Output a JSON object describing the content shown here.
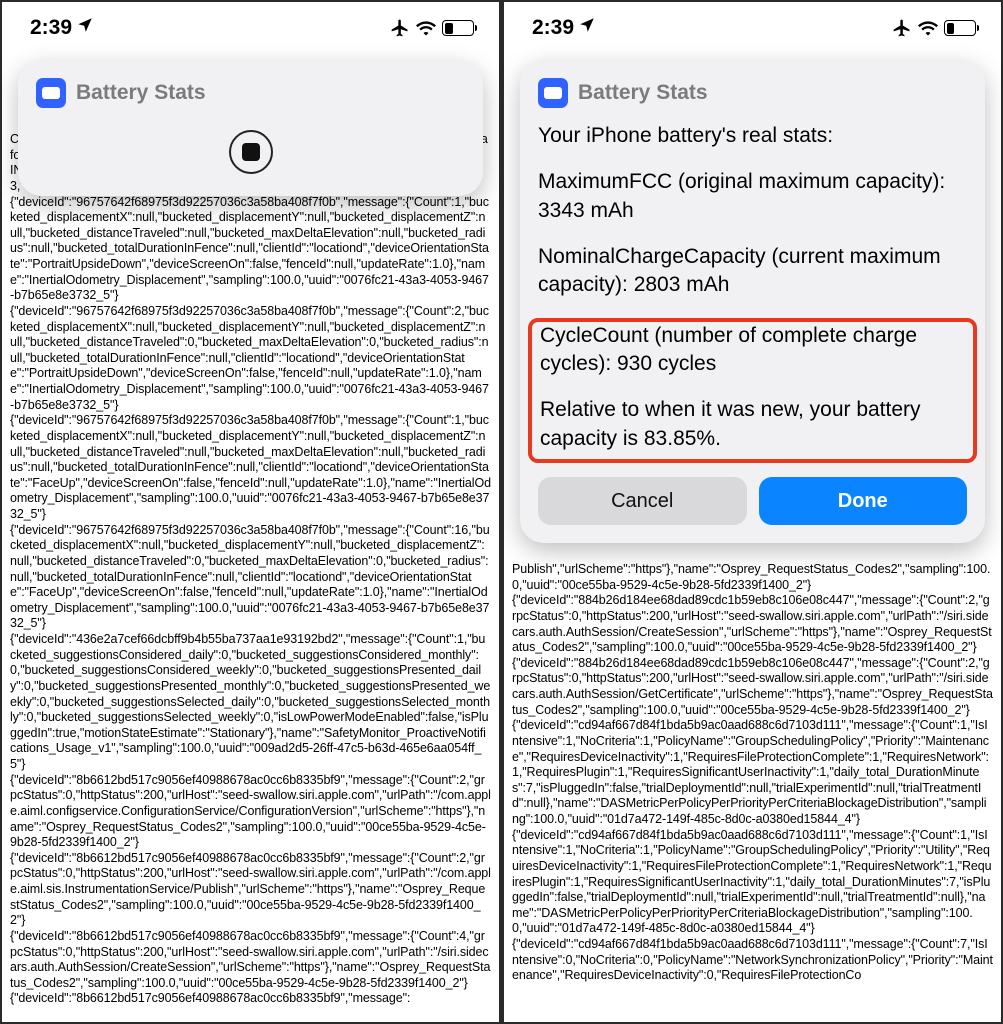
{
  "statusbar": {
    "time": "2:39",
    "battery_left": "30",
    "battery_right": "29"
  },
  "card": {
    "title": "Battery Stats"
  },
  "stats": {
    "heading": "Your iPhone battery's real stats:",
    "max_fcc": "MaximumFCC (original maximum capacity): 3343 mAh",
    "nominal": "NominalChargeCapacity (current maximum capacity): 2803 mAh",
    "cycles": "CycleCount (number of complete charge cycles): 930 cycles",
    "relative": "Relative to when it was new, your battery capacity is 83.85%."
  },
  "buttons": {
    "cancel": "Cancel",
    "done": "Done"
  },
  "bg_left": "Carrie.\",\"productSku\":\"HN/A\",\"rolloverReason\":\"scheduled\",\"servingCarrierName\":\"Vodafone India\nIN\",\"startTimestamp\":\"2024-01-05T00:15:00Z\",\"stateDbType\":\"sqlite\",\"stateDbVersion\":3,\"trialExperiments\":\"2\",\"trialRollouts\":\"2\",\"version\":\"2.4\"}\n{\"deviceId\":\"96757642f68975f3d92257036c3a58ba408f7f0b\",\"message\":{\"Count\":1,\"bucketed_displacementX\":null,\"bucketed_displacementY\":null,\"bucketed_displacementZ\":null,\"bucketed_distanceTraveled\":null,\"bucketed_maxDeltaElevation\":null,\"bucketed_radius\":null,\"bucketed_totalDurationInFence\":null,\"clientId\":\"locationd\",\"deviceOrientationState\":\"PortraitUpsideDown\",\"deviceScreenOn\":false,\"fenceId\":null,\"updateRate\":1.0},\"name\":\"InertialOdometry_Displacement\",\"sampling\":100.0,\"uuid\":\"0076fc21-43a3-4053-9467-b7b65e8e3732_5\"}\n{\"deviceId\":\"96757642f68975f3d92257036c3a58ba408f7f0b\",\"message\":{\"Count\":2,\"bucketed_displacementX\":null,\"bucketed_displacementY\":null,\"bucketed_displacementZ\":null,\"bucketed_distanceTraveled\":0,\"bucketed_maxDeltaElevation\":0,\"bucketed_radius\":null,\"bucketed_totalDurationInFence\":null,\"clientId\":\"locationd\",\"deviceOrientationState\":\"PortraitUpsideDown\",\"deviceScreenOn\":false,\"fenceId\":null,\"updateRate\":1.0},\"name\":\"InertialOdometry_Displacement\",\"sampling\":100.0,\"uuid\":\"0076fc21-43a3-4053-9467-b7b65e8e3732_5\"}\n{\"deviceId\":\"96757642f68975f3d92257036c3a58ba408f7f0b\",\"message\":{\"Count\":1,\"bucketed_displacementX\":null,\"bucketed_displacementY\":null,\"bucketed_displacementZ\":null,\"bucketed_distanceTraveled\":null,\"bucketed_maxDeltaElevation\":null,\"bucketed_radius\":null,\"bucketed_totalDurationInFence\":null,\"clientId\":\"locationd\",\"deviceOrientationState\":\"FaceUp\",\"deviceScreenOn\":false,\"fenceId\":null,\"updateRate\":1.0},\"name\":\"InertialOdometry_Displacement\",\"sampling\":100.0,\"uuid\":\"0076fc21-43a3-4053-9467-b7b65e8e3732_5\"}\n{\"deviceId\":\"96757642f68975f3d92257036c3a58ba408f7f0b\",\"message\":{\"Count\":16,\"bucketed_displacementX\":null,\"bucketed_displacementY\":null,\"bucketed_displacementZ\":null,\"bucketed_distanceTraveled\":0,\"bucketed_maxDeltaElevation\":0,\"bucketed_radius\":null,\"bucketed_totalDurationInFence\":null,\"clientId\":\"locationd\",\"deviceOrientationState\":\"FaceUp\",\"deviceScreenOn\":false,\"fenceId\":null,\"updateRate\":1.0},\"name\":\"InertialOdometry_Displacement\",\"sampling\":100.0,\"uuid\":\"0076fc21-43a3-4053-9467-b7b65e8e3732_5\"}\n{\"deviceId\":\"436e2a7cef66dcbff9b4b55ba737aa1e93192bd2\",\"message\":{\"Count\":1,\"bucketed_suggestionsConsidered_daily\":0,\"bucketed_suggestionsConsidered_monthly\":0,\"bucketed_suggestionsConsidered_weekly\":0,\"bucketed_suggestionsPresented_daily\":0,\"bucketed_suggestionsPresented_monthly\":0,\"bucketed_suggestionsPresented_weekly\":0,\"bucketed_suggestionsSelected_daily\":0,\"bucketed_suggestionsSelected_monthly\":0,\"bucketed_suggestionsSelected_weekly\":0,\"isLowPowerModeEnabled\":false,\"isPluggedIn\":true,\"motionStateEstimate\":\"Stationary\"},\"name\":\"SafetyMonitor_ProactiveNotifications_Usage_v1\",\"sampling\":100.0,\"uuid\":\"009ad2d5-26ff-47c5-b63d-465e6aa054ff_5\"}\n{\"deviceId\":\"8b6612bd517c9056ef40988678ac0cc6b8335bf9\",\"message\":{\"Count\":2,\"grpcStatus\":0,\"httpStatus\":200,\"urlHost\":\"seed-swallow.siri.apple.com\",\"urlPath\":\"/com.apple.aiml.configservice.ConfigurationService/ConfigurationVersion\",\"urlScheme\":\"https\"},\"name\":\"Osprey_RequestStatus_Codes2\",\"sampling\":100.0,\"uuid\":\"00ce55ba-9529-4c5e-9b28-5fd2339f1400_2\"}\n{\"deviceId\":\"8b6612bd517c9056ef40988678ac0cc6b8335bf9\",\"message\":{\"Count\":2,\"grpcStatus\":0,\"httpStatus\":200,\"urlHost\":\"seed-swallow.siri.apple.com\",\"urlPath\":\"/com.apple.aiml.sis.InstrumentationService/Publish\",\"urlScheme\":\"https\"},\"name\":\"Osprey_RequestStatus_Codes2\",\"sampling\":100.0,\"uuid\":\"00ce55ba-9529-4c5e-9b28-5fd2339f1400_2\"}\n{\"deviceId\":\"8b6612bd517c9056ef40988678ac0cc6b8335bf9\",\"message\":{\"Count\":4,\"grpcStatus\":0,\"httpStatus\":200,\"urlHost\":\"seed-swallow.siri.apple.com\",\"urlPath\":\"/siri.sidecars.auth.AuthSession/CreateSession\",\"urlScheme\":\"https\"},\"name\":\"Osprey_RequestStatus_Codes2\",\"sampling\":100.0,\"uuid\":\"00ce55ba-9529-4c5e-9b28-5fd2339f1400_2\"}\n{\"deviceId\":\"8b6612bd517c9056ef40988678ac0cc6b8335bf9\",\"message\":",
  "bg_right": "Publish\",\"urlScheme\":\"https\"},\"name\":\"Osprey_RequestStatus_Codes2\",\"sampling\":100.0,\"uuid\":\"00ce55ba-9529-4c5e-9b28-5fd2339f1400_2\"}\n{\"deviceId\":\"884b26d184ee68dad89cdc1b59eb8c106e08c447\",\"message\":{\"Count\":2,\"grpcStatus\":0,\"httpStatus\":200,\"urlHost\":\"seed-swallow.siri.apple.com\",\"urlPath\":\"/siri.sidecars.auth.AuthSession/CreateSession\",\"urlScheme\":\"https\"},\"name\":\"Osprey_RequestStatus_Codes2\",\"sampling\":100.0,\"uuid\":\"00ce55ba-9529-4c5e-9b28-5fd2339f1400_2\"}\n{\"deviceId\":\"884b26d184ee68dad89cdc1b59eb8c106e08c447\",\"message\":{\"Count\":2,\"grpcStatus\":0,\"httpStatus\":200,\"urlHost\":\"seed-swallow.siri.apple.com\",\"urlPath\":\"/siri.sidecars.auth.AuthSession/GetCertificate\",\"urlScheme\":\"https\"},\"name\":\"Osprey_RequestStatus_Codes2\",\"sampling\":100.0,\"uuid\":\"00ce55ba-9529-4c5e-9b28-5fd2339f1400_2\"}\n{\"deviceId\":\"cd94af667d84f1bda5b9ac0aad688c6d7103d111\",\"message\":{\"Count\":1,\"IsIntensive\":1,\"NoCriteria\":1,\"PolicyName\":\"GroupSchedulingPolicy\",\"Priority\":\"Maintenance\",\"RequiresDeviceInactivity\":1,\"RequiresFileProtectionComplete\":1,\"RequiresNetwork\":1,\"RequiresPlugin\":1,\"RequiresSignificantUserInactivity\":1,\"daily_total_DurationMinutes\":7,\"isPluggedIn\":false,\"trialDeploymentId\":null,\"trialExperimentId\":null,\"trialTreatmentId\":null},\"name\":\"DASMetricPerPolicyPerPriorityPerCriteriaBlockageDistribution\",\"sampling\":100.0,\"uuid\":\"01d7a472-149f-485c-8d0c-a0380ed15844_4\"}\n{\"deviceId\":\"cd94af667d84f1bda5b9ac0aad688c6d7103d111\",\"message\":{\"Count\":1,\"IsIntensive\":1,\"NoCriteria\":1,\"PolicyName\":\"GroupSchedulingPolicy\",\"Priority\":\"Utility\",\"RequiresDeviceInactivity\":1,\"RequiresFileProtectionComplete\":1,\"RequiresNetwork\":1,\"RequiresPlugin\":1,\"RequiresSignificantUserInactivity\":1,\"daily_total_DurationMinutes\":7,\"isPluggedIn\":false,\"trialDeploymentId\":null,\"trialExperimentId\":null,\"trialTreatmentId\":null},\"name\":\"DASMetricPerPolicyPerPriorityPerCriteriaBlockageDistribution\",\"sampling\":100.0,\"uuid\":\"01d7a472-149f-485c-8d0c-a0380ed15844_4\"}\n{\"deviceId\":\"cd94af667d84f1bda5b9ac0aad688c6d7103d111\",\"message\":{\"Count\":7,\"IsIntensive\":0,\"NoCriteria\":0,\"PolicyName\":\"NetworkSynchronizationPolicy\",\"Priority\":\"Maintenance\",\"RequiresDeviceInactivity\":0,\"RequiresFileProtectionCo"
}
